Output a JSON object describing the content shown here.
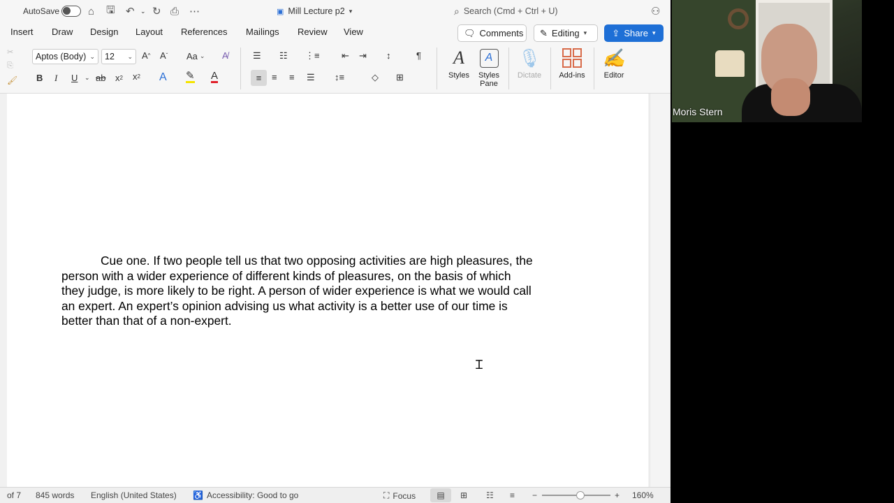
{
  "titlebar": {
    "autosave_label": "AutoSave",
    "doc_title": "Mill Lecture p2",
    "search_placeholder": "Search (Cmd + Ctrl + U)"
  },
  "tabs": [
    "Insert",
    "Draw",
    "Design",
    "Layout",
    "References",
    "Mailings",
    "Review",
    "View"
  ],
  "actions": {
    "comments_label": "Comments",
    "editing_label": "Editing",
    "share_label": "Share"
  },
  "ribbon": {
    "font_name": "Aptos (Body)",
    "font_size": "12",
    "change_case": "Aa",
    "styles_label": "Styles",
    "styles_pane_label_1": "Styles",
    "styles_pane_label_2": "Pane",
    "dictate_label": "Dictate",
    "addins_label": "Add-ins",
    "editor_label": "Editor"
  },
  "document": {
    "lines": [
      "Cue one.  If two people tell us that two opposing activities are high pleasures, the",
      "person with a wider experience of different kinds of pleasures, on the basis of which",
      "they judge, is more likely to be right.  A person of wider experience is what we would call",
      "an expert.  An expert’s opinion advising us what activity is a better use of our time is",
      "better than that of a non-expert."
    ]
  },
  "status": {
    "page": "of 7",
    "words": "845 words",
    "language": "English (United States)",
    "accessibility": "Accessibility: Good to go",
    "focus": "Focus",
    "zoom": "160%",
    "zoom_level": 1.6
  },
  "video": {
    "participant": "Moris Stern"
  },
  "colors": {
    "share_bg": "#1e6fd6",
    "highlight": "#f5e400",
    "font_color": "#e0202a",
    "addins": "#d86b4a"
  }
}
